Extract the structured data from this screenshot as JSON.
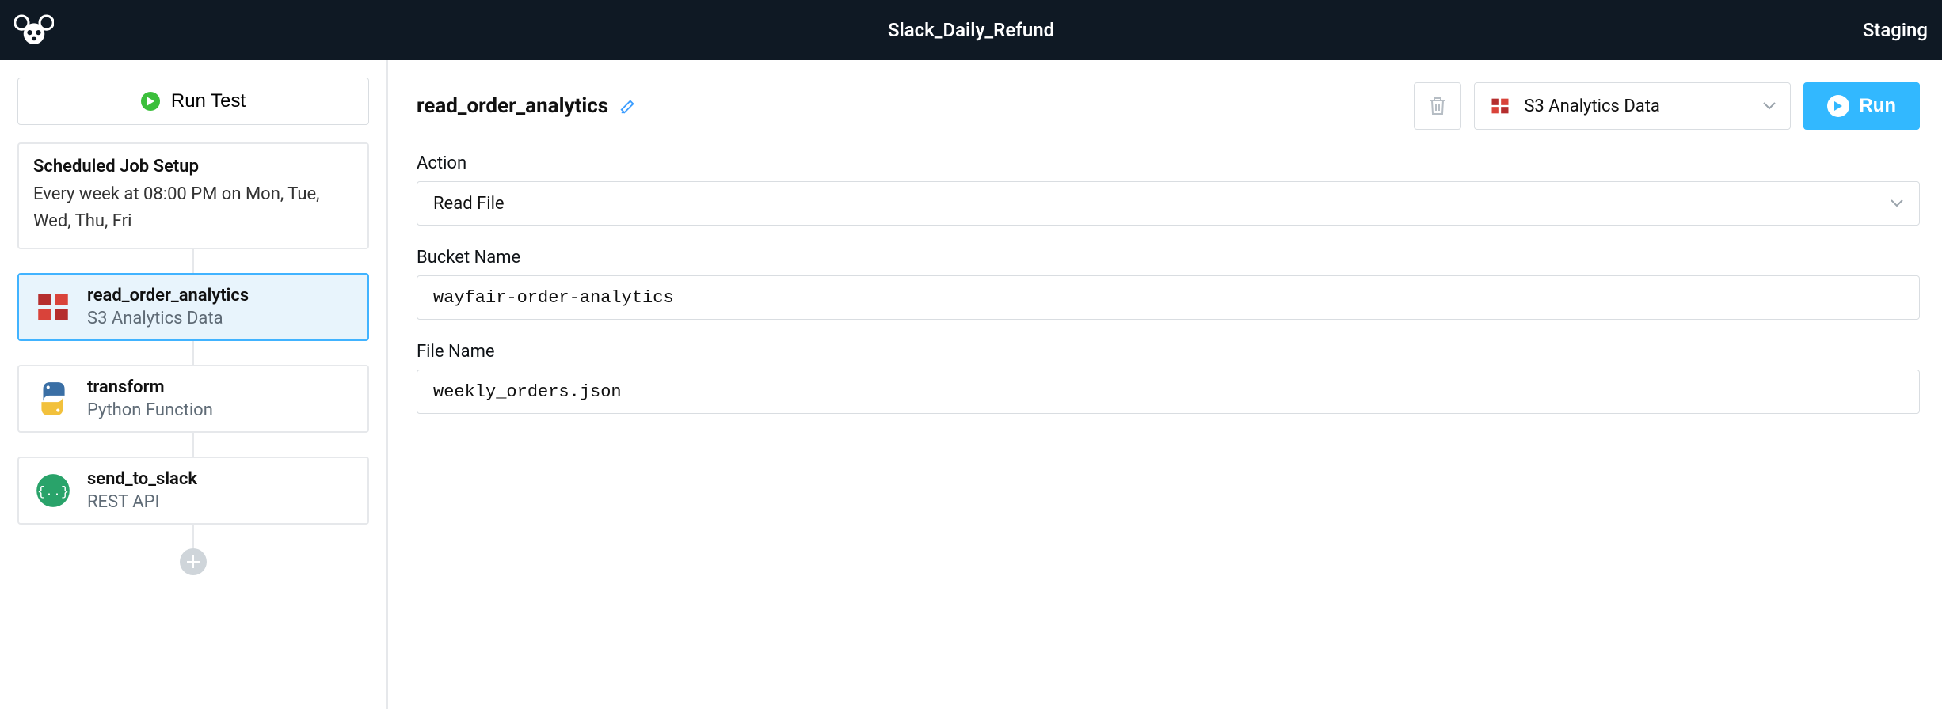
{
  "header": {
    "title": "Slack_Daily_Refund",
    "env_label": "Staging"
  },
  "sidebar": {
    "run_test_label": "Run Test",
    "schedule": {
      "title": "Scheduled Job Setup",
      "description": "Every week at 08:00 PM on Mon, Tue, Wed, Thu, Fri"
    },
    "steps": [
      {
        "name": "read_order_analytics",
        "subtitle": "S3 Analytics Data",
        "icon": "aws-icon",
        "selected": true
      },
      {
        "name": "transform",
        "subtitle": "Python Function",
        "icon": "python-icon",
        "selected": false
      },
      {
        "name": "send_to_slack",
        "subtitle": "REST API",
        "icon": "rest-api-icon",
        "selected": false
      }
    ]
  },
  "main": {
    "title": "read_order_analytics",
    "connection": {
      "label": "S3 Analytics Data",
      "icon": "aws-icon"
    },
    "run_label": "Run",
    "fields": {
      "action": {
        "label": "Action",
        "value": "Read File"
      },
      "bucket": {
        "label": "Bucket Name",
        "value": "wayfair-order-analytics"
      },
      "file": {
        "label": "File Name",
        "value": "weekly_orders.json"
      }
    }
  }
}
